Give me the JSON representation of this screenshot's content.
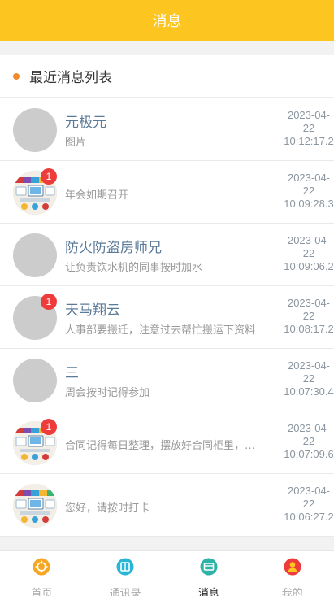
{
  "header": {
    "title": "消息"
  },
  "section": {
    "label": "最近消息列表"
  },
  "colors": {
    "brand": "#fcc51f",
    "accent_dot": "#f08b2c",
    "badge": "#ee3b3b"
  },
  "messages": [
    {
      "avatar": "placeholder",
      "badge": "",
      "name": "元极元",
      "preview": "图片",
      "date": "2023-04-",
      "day": "22",
      "time": "10:12:17.2"
    },
    {
      "avatar": "office-image",
      "badge": "1",
      "name": "",
      "preview": "年会如期召开",
      "date": "2023-04-",
      "day": "22",
      "time": "10:09:28.3"
    },
    {
      "avatar": "placeholder",
      "badge": "",
      "name": "防火防盗房师兄",
      "preview": "让负责饮水机的同事按时加水",
      "date": "2023-04-",
      "day": "22",
      "time": "10:09:06.2"
    },
    {
      "avatar": "placeholder",
      "badge": "1",
      "name": "天马翔云",
      "preview": "人事部要搬迁，注意过去帮忙搬运下资料",
      "date": "2023-04-",
      "day": "22",
      "time": "10:08:17.2"
    },
    {
      "avatar": "placeholder",
      "badge": "",
      "name": "三",
      "preview": "周会按时记得参加",
      "date": "2023-04-",
      "day": "22",
      "time": "10:07:30.4"
    },
    {
      "avatar": "office-image",
      "badge": "1",
      "name": "",
      "preview": "合同记得每日整理，摆放好合同柜里，…",
      "date": "2023-04-",
      "day": "22",
      "time": "10:07:09.6"
    },
    {
      "avatar": "office-image",
      "badge": "",
      "name": "",
      "preview": "您好，请按时打卡",
      "date": "2023-04-",
      "day": "22",
      "time": "10:06:27.2"
    }
  ],
  "tabs": [
    {
      "label": "首页",
      "icon": "home-icon",
      "color": "#f5a623",
      "active": false
    },
    {
      "label": "通讯录",
      "icon": "contacts-icon",
      "color": "#29b6d6",
      "active": false
    },
    {
      "label": "消息",
      "icon": "message-icon",
      "color": "#2fb3a6",
      "active": true
    },
    {
      "label": "我的",
      "icon": "profile-icon",
      "color": "#ee3b3b",
      "active": false
    }
  ]
}
